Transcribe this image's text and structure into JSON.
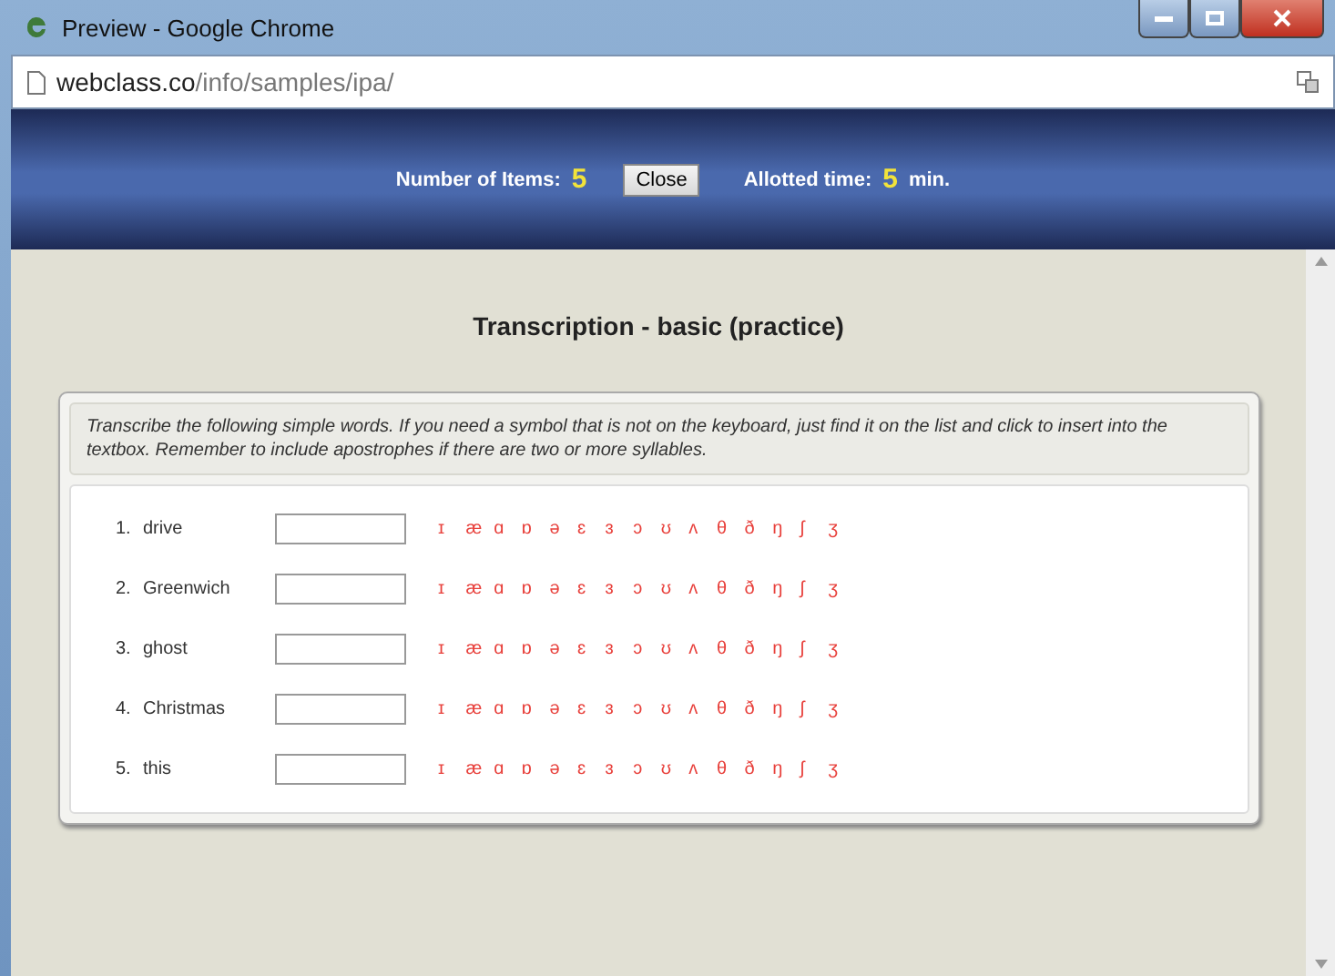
{
  "window": {
    "title": "Preview - Google Chrome"
  },
  "address_bar": {
    "host": "webclass.co",
    "path": "/info/samples/ipa/"
  },
  "header": {
    "items_label": "Number of Items:",
    "items_value": "5",
    "close_button": "Close",
    "time_label": "Allotted time:",
    "time_value": "5",
    "time_unit": "min."
  },
  "title": "Transcription - basic (practice)",
  "instructions": "Transcribe the following simple words. If you need a symbol that is not on the keyboard, just find it on the list and click to insert into the textbox. Remember to include apostrophes if there are two or more syllables.",
  "items": [
    {
      "number": "1.",
      "word": "drive",
      "symbols": [
        "ɪ",
        "æ",
        "ɑ",
        "ɒ",
        "ə",
        "ɛ",
        "ɜ",
        "ɔ",
        "ʊ",
        "ʌ",
        "θ",
        "ð",
        "ŋ",
        "ʃ",
        "ʒ"
      ]
    },
    {
      "number": "2.",
      "word": "Greenwich",
      "symbols": [
        "ɪ",
        "æ",
        "ɑ",
        "ɒ",
        "ə",
        "ɛ",
        "ɜ",
        "ɔ",
        "ʊ",
        "ʌ",
        "θ",
        "ð",
        "ŋ",
        "ʃ",
        "ʒ"
      ]
    },
    {
      "number": "3.",
      "word": "ghost",
      "symbols": [
        "ɪ",
        "æ",
        "ɑ",
        "ɒ",
        "ə",
        "ɛ",
        "ɜ",
        "ɔ",
        "ʊ",
        "ʌ",
        "θ",
        "ð",
        "ŋ",
        "ʃ",
        "ʒ"
      ]
    },
    {
      "number": "4.",
      "word": "Christmas",
      "symbols": [
        "ɪ",
        "æ",
        "ɑ",
        "ɒ",
        "ə",
        "ɛ",
        "ɜ",
        "ɔ",
        "ʊ",
        "ʌ",
        "θ",
        "ð",
        "ŋ",
        "ʃ",
        "ʒ"
      ]
    },
    {
      "number": "5.",
      "word": "this",
      "symbols": [
        "ɪ",
        "æ",
        "ɑ",
        "ɒ",
        "ə",
        "ɛ",
        "ɜ",
        "ɔ",
        "ʊ",
        "ʌ",
        "θ",
        "ð",
        "ŋ",
        "ʃ",
        "ʒ"
      ]
    }
  ]
}
